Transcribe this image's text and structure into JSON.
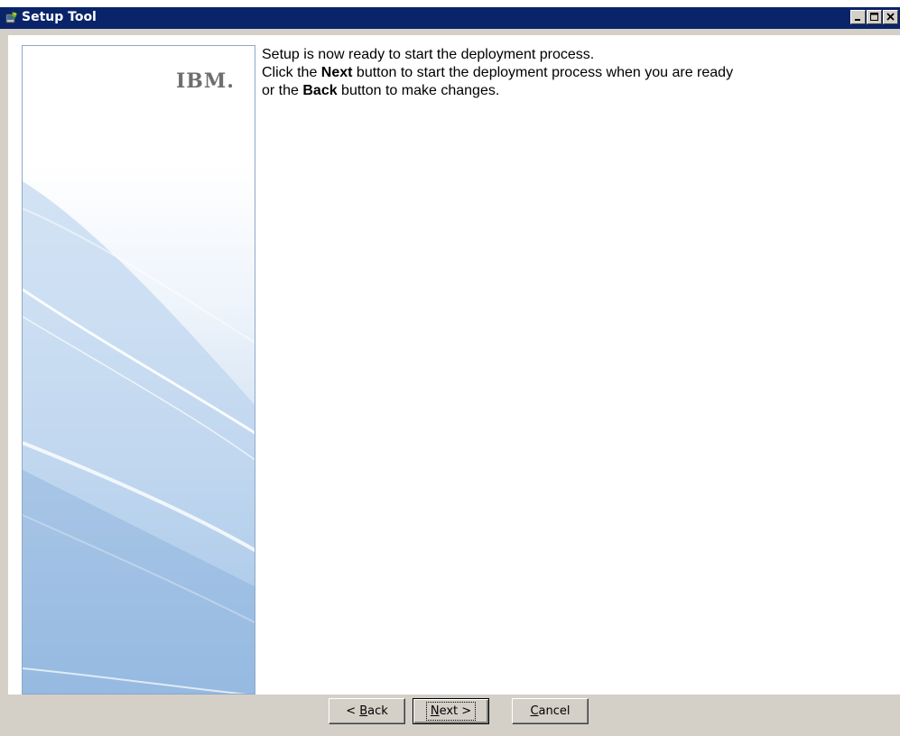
{
  "window": {
    "title": "Setup Tool",
    "icon": "setup-tool-icon",
    "controls": [
      "minimize-icon",
      "maximize-icon",
      "close-icon"
    ]
  },
  "side_panel": {
    "logo_text": "IBM."
  },
  "main": {
    "line1": "Setup is now ready to start the deployment process.",
    "line2_prefix": "Click the ",
    "line2_bold": "Next",
    "line2_suffix": " button to start the deployment process when you are ready",
    "line3_prefix": "or the ",
    "line3_bold": "Back",
    "line3_suffix": " button to make changes."
  },
  "buttons": {
    "back": {
      "prefix": "< ",
      "mnemonic": "B",
      "rest": "ack"
    },
    "next": {
      "mnemonic": "N",
      "rest": "ext >"
    },
    "cancel": {
      "mnemonic": "C",
      "rest": "ancel"
    }
  },
  "colors": {
    "titlebar": "#0a246a",
    "dialog_face": "#d4d0c8",
    "panel_blue": "#8bb2dd"
  }
}
